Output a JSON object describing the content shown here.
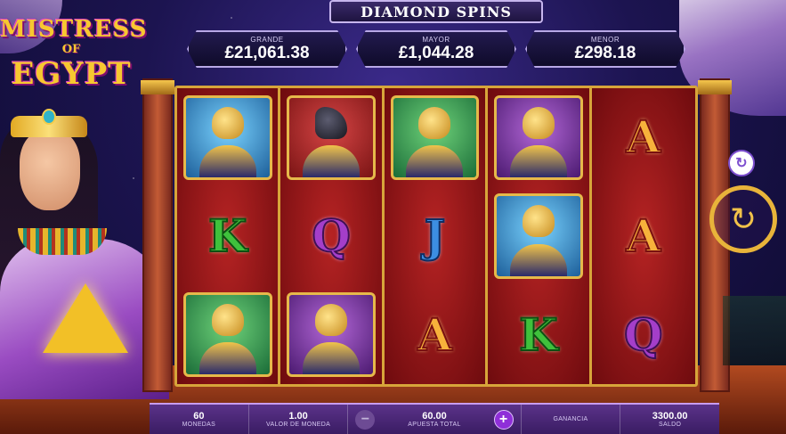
{
  "game": {
    "logo_line1": "MISTRESS",
    "logo_line2": "OF",
    "logo_line3": "EGYPT"
  },
  "jackpots": {
    "title": "DIAMOND SPINS",
    "items": [
      {
        "label": "GRANDE",
        "value": "£21,061.38"
      },
      {
        "label": "MAYOR",
        "value": "£1,044.28"
      },
      {
        "label": "MENOR",
        "value": "£298.18"
      }
    ]
  },
  "reels": [
    [
      {
        "type": "tile",
        "symbol": "horus-blue"
      },
      {
        "type": "card",
        "symbol": "K"
      },
      {
        "type": "tile",
        "symbol": "horus-green"
      }
    ],
    [
      {
        "type": "tile",
        "symbol": "anubis"
      },
      {
        "type": "card",
        "symbol": "Q"
      },
      {
        "type": "tile",
        "symbol": "cat"
      }
    ],
    [
      {
        "type": "tile",
        "symbol": "horus-green"
      },
      {
        "type": "card",
        "symbol": "J"
      },
      {
        "type": "card",
        "symbol": "A"
      }
    ],
    [
      {
        "type": "tile",
        "symbol": "cat"
      },
      {
        "type": "tile",
        "symbol": "horus-blue"
      },
      {
        "type": "card",
        "symbol": "K"
      }
    ],
    [
      {
        "type": "card",
        "symbol": "A"
      },
      {
        "type": "card",
        "symbol": "A"
      },
      {
        "type": "card",
        "symbol": "Q"
      }
    ]
  ],
  "controls": {
    "swap_icon": "↻",
    "spin_icon": "↻"
  },
  "bottom_bar": {
    "coins_value": "60",
    "coins_label": "MONEDAS",
    "coin_value": "1.00",
    "coin_value_label": "VALOR DE MONEDA",
    "bet_minus": "−",
    "bet_value": "60.00",
    "bet_label": "APUESTA TOTAL",
    "bet_plus": "+",
    "win_value": "",
    "win_label": "GANANCIA",
    "balance_value": "3300.00",
    "balance_label": "SALDO"
  }
}
